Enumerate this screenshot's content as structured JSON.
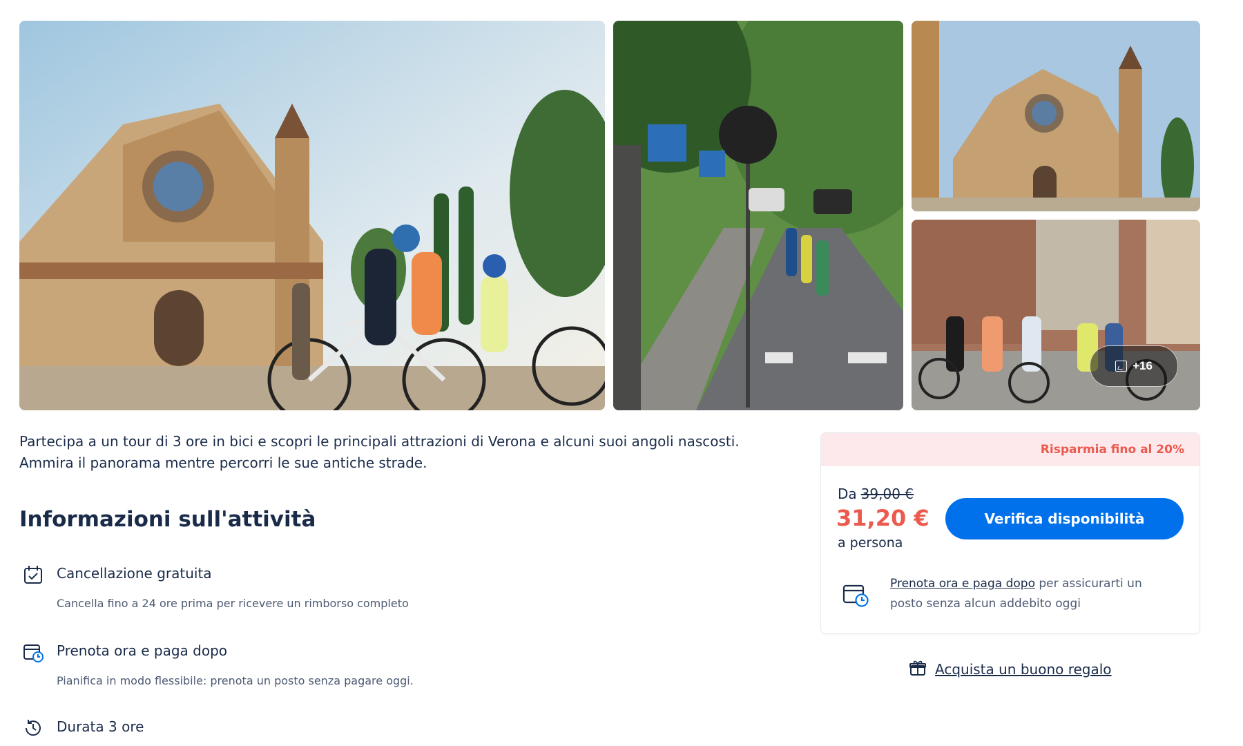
{
  "gallery": {
    "more_photos_label": "+16",
    "photos": [
      {
        "name": "basilica-bike-group"
      },
      {
        "name": "cyclists-on-road"
      },
      {
        "name": "basilica-facade"
      },
      {
        "name": "group-with-bikes"
      }
    ]
  },
  "description": "Partecipa a un tour di 3 ore in bici e scopri le principali attrazioni di Verona e alcuni suoi angoli nascosti. Ammira il panorama mentre percorri le sue antiche strade.",
  "info": {
    "title": "Informazioni sull'attività",
    "features": [
      {
        "title": "Cancellazione gratuita",
        "desc": "Cancella fino a 24 ore prima per ricevere un rimborso completo",
        "icon": "calendar-check-icon"
      },
      {
        "title": "Prenota ora e paga dopo",
        "desc": "Pianifica in modo flessibile: prenota un posto senza pagare oggi.",
        "icon": "calendar-clock-icon"
      },
      {
        "title": "Durata 3 ore",
        "icon": "history-clock-icon"
      }
    ]
  },
  "booking": {
    "discount": "Risparmia fino al 20%",
    "from_label": "Da",
    "old_price": "39,00 €",
    "price": "31,20 €",
    "per_label": "a persona",
    "cta": "Verifica disponibilità",
    "pay_later_link": "Prenota ora e paga dopo",
    "pay_later_rest": " per assicurarti un posto senza alcun addebito oggi"
  },
  "gift": {
    "label": "Acquista un buono regalo",
    "icon": "gift-icon"
  },
  "colors": {
    "accent": "#0071eb",
    "price": "#eb5a4d",
    "discount_bg": "#fde8ec",
    "text": "#1a2b49"
  }
}
